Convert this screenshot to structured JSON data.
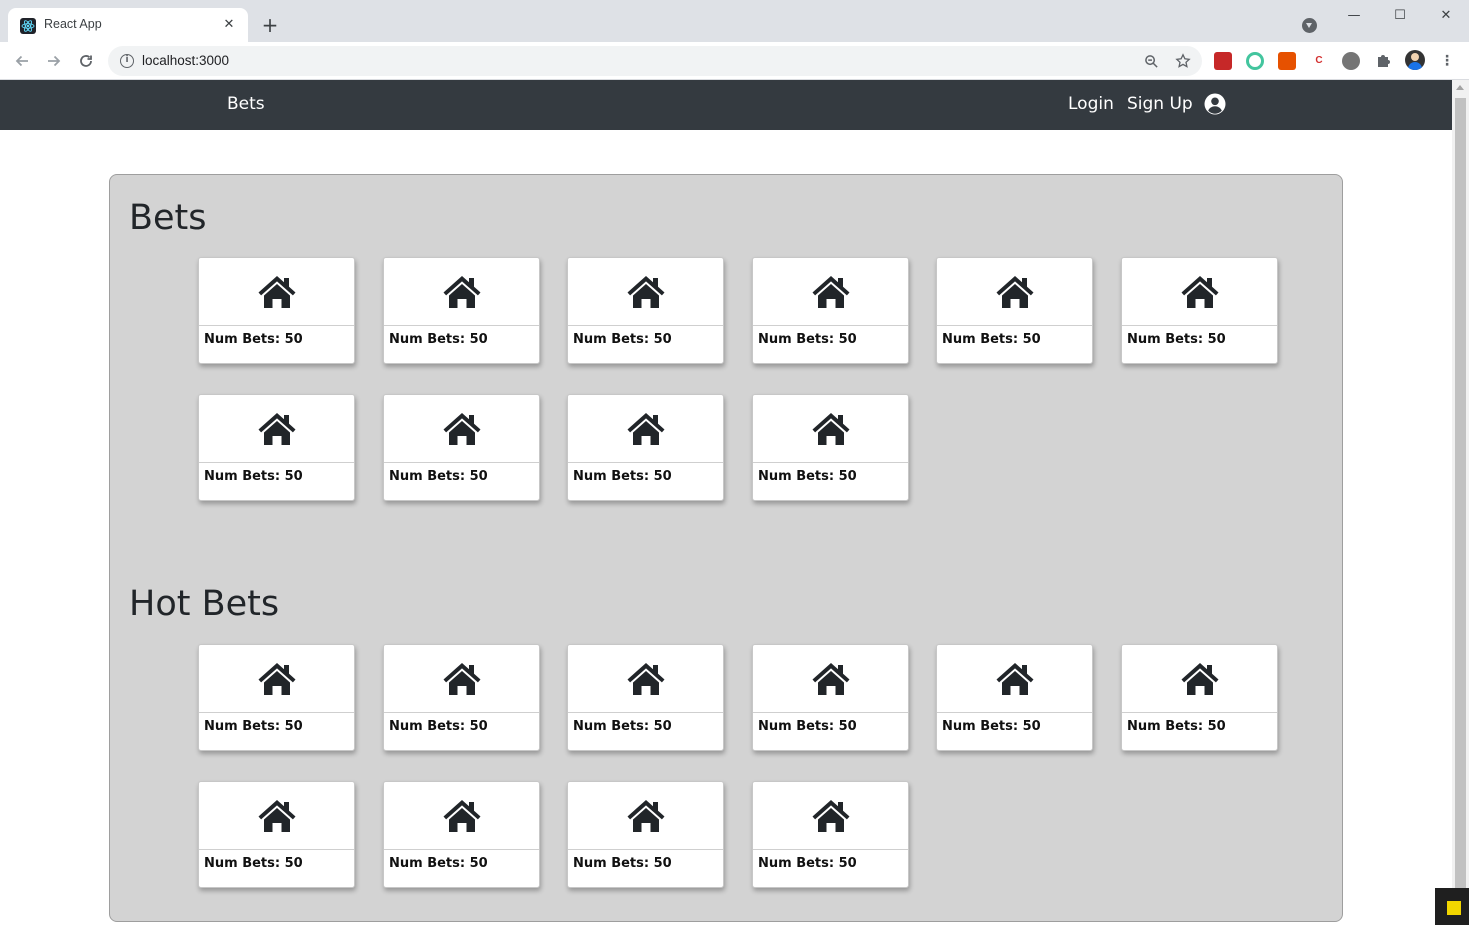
{
  "browser": {
    "tab_title": "React App",
    "tab_close": "✕",
    "new_tab": "+",
    "url": "localhost:3000",
    "window_controls": {
      "minimize": "—",
      "maximize": "☐",
      "close": "✕"
    },
    "extensions": [
      "red-extension-icon",
      "green-ring-extension-icon",
      "pdf-extension-icon",
      "c-extension-icon",
      "sphere-extension-icon",
      "puzzle-extension-icon"
    ]
  },
  "navbar": {
    "brand": "Bets",
    "login": "Login",
    "signup": "Sign Up",
    "background": "#343a40"
  },
  "sections": [
    {
      "title": "Bets",
      "cards": [
        {
          "label": "Num Bets: 50"
        },
        {
          "label": "Num Bets: 50"
        },
        {
          "label": "Num Bets: 50"
        },
        {
          "label": "Num Bets: 50"
        },
        {
          "label": "Num Bets: 50"
        },
        {
          "label": "Num Bets: 50"
        },
        {
          "label": "Num Bets: 50"
        },
        {
          "label": "Num Bets: 50"
        },
        {
          "label": "Num Bets: 50"
        },
        {
          "label": "Num Bets: 50"
        }
      ]
    },
    {
      "title": "Hot Bets",
      "cards": [
        {
          "label": "Num Bets: 50"
        },
        {
          "label": "Num Bets: 50"
        },
        {
          "label": "Num Bets: 50"
        },
        {
          "label": "Num Bets: 50"
        },
        {
          "label": "Num Bets: 50"
        },
        {
          "label": "Num Bets: 50"
        },
        {
          "label": "Num Bets: 50"
        },
        {
          "label": "Num Bets: 50"
        },
        {
          "label": "Num Bets: 50"
        },
        {
          "label": "Num Bets: 50"
        }
      ]
    }
  ],
  "card_icon": "house-icon",
  "colors": {
    "panel": "#d3d3d3",
    "card": "#ffffff",
    "icon": "#212529"
  }
}
